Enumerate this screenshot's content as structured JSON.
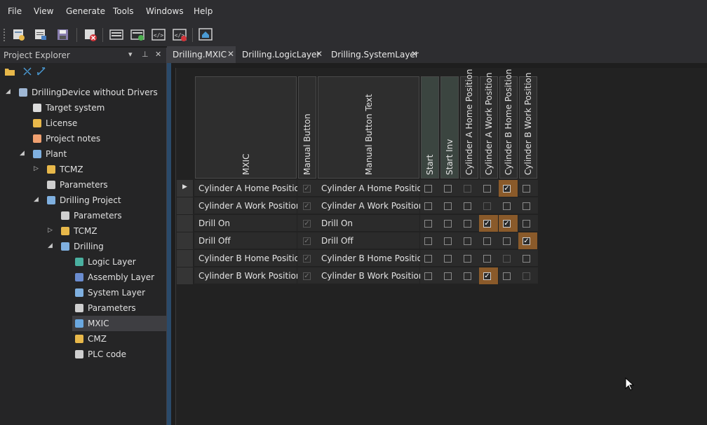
{
  "menu": [
    "File",
    "View",
    "Generate",
    "Tools",
    "Windows",
    "Help"
  ],
  "toolbar": {
    "buttons": [
      "new-project-icon",
      "properties-icon",
      "save-icon",
      "delete-icon",
      "form-icon",
      "form-add-icon",
      "code-icon",
      "code-remove-icon",
      "home-icon"
    ]
  },
  "explorer": {
    "title": "Project Explorer",
    "tree": [
      {
        "label": "DrillingDevice without Drivers",
        "icon": "project-icon",
        "arrow": "◢"
      },
      {
        "label": "Target system",
        "icon": "target-system-icon",
        "arrow": ""
      },
      {
        "label": "License",
        "icon": "key-icon",
        "arrow": ""
      },
      {
        "label": "Project notes",
        "icon": "notes-icon",
        "arrow": ""
      },
      {
        "label": "Plant",
        "icon": "plant-icon",
        "arrow": "◢"
      },
      {
        "label": "TCMZ",
        "icon": "folder-icon",
        "arrow": "▷"
      },
      {
        "label": "Parameters",
        "icon": "parameters-icon",
        "arrow": ""
      },
      {
        "label": "Drilling Project",
        "icon": "cube-icon",
        "arrow": "◢"
      },
      {
        "label": "Parameters",
        "icon": "parameters-icon",
        "arrow": ""
      },
      {
        "label": "TCMZ",
        "icon": "folder-icon",
        "arrow": "▷"
      },
      {
        "label": "Drilling",
        "icon": "cube-icon",
        "arrow": "◢"
      },
      {
        "label": "Logic Layer",
        "icon": "logic-layer-icon",
        "arrow": ""
      },
      {
        "label": "Assembly Layer",
        "icon": "assembly-layer-icon",
        "arrow": ""
      },
      {
        "label": "System Layer",
        "icon": "system-layer-icon",
        "arrow": ""
      },
      {
        "label": "Parameters",
        "icon": "parameters-icon",
        "arrow": ""
      },
      {
        "label": "MXIC",
        "icon": "mxic-icon",
        "arrow": ""
      },
      {
        "label": "CMZ",
        "icon": "folder-icon",
        "arrow": ""
      },
      {
        "label": "PLC code",
        "icon": "plc-code-icon",
        "arrow": ""
      }
    ]
  },
  "tabs": [
    {
      "label": "Drilling.MXIC",
      "active": true
    },
    {
      "label": "Drilling.LogicLayer",
      "active": false
    },
    {
      "label": "Drilling.SystemLayer",
      "active": false
    }
  ],
  "grid": {
    "columns": {
      "mxic": "MXIC",
      "manual_button": "Manual Button",
      "manual_button_text": "Manual Button Text",
      "signals": [
        "Start",
        "Start Inv",
        "Cylinder A Home Position",
        "Cylinder A Work Position",
        "Cylinder B Home Position",
        "Cylinder B Work Position"
      ]
    },
    "rows": [
      {
        "mxic": "Cylinder A Home Position",
        "manual_text": "Cylinder A Home Position",
        "checks": [
          0,
          0,
          2,
          0,
          1,
          0
        ]
      },
      {
        "mxic": "Cylinder A Work Position",
        "manual_text": "Cylinder A Work Position",
        "checks": [
          0,
          0,
          0,
          2,
          0,
          0
        ]
      },
      {
        "mxic": "Drill On",
        "manual_text": "Drill On",
        "checks": [
          0,
          0,
          0,
          1,
          1,
          0
        ]
      },
      {
        "mxic": "Drill Off",
        "manual_text": "Drill Off",
        "checks": [
          0,
          0,
          0,
          0,
          0,
          1
        ]
      },
      {
        "mxic": "Cylinder B Home Position",
        "manual_text": "Cylinder B Home Position",
        "checks": [
          0,
          0,
          0,
          0,
          2,
          0
        ]
      },
      {
        "mxic": "Cylinder B Work Position",
        "manual_text": "Cylinder B Work Position",
        "checks": [
          0,
          0,
          0,
          1,
          0,
          2
        ]
      }
    ],
    "check_legend": "0 = unchecked, 1 = checked (highlighted), 2 = disabled"
  },
  "colors": {
    "highlight": "#8a5a2a",
    "signal_header_dark": "#3b4540"
  }
}
